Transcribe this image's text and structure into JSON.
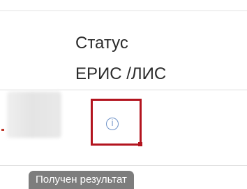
{
  "table": {
    "column_header": {
      "line1": "Статус",
      "line2": "ЕРИС /ЛИС"
    },
    "row": {
      "status_icon": "info-icon",
      "status_glyph": "i"
    }
  },
  "tooltip": {
    "text": "Получен результат"
  },
  "colors": {
    "highlight": "#b3141f",
    "icon": "#6f93c8",
    "tooltip_bg": "#7d7d7d"
  }
}
